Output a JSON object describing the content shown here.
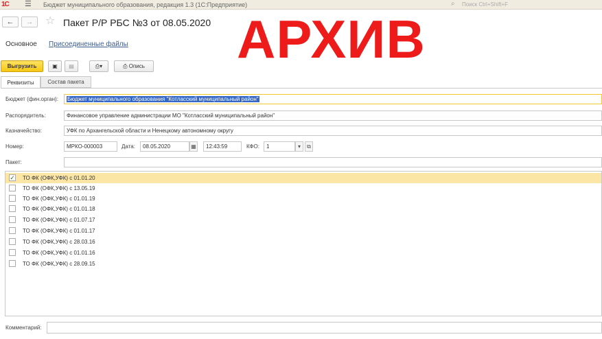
{
  "titlebar": {
    "logo": "1С",
    "app_title": "Бюджет муниципального образования, редакция 1.3  (1С:Предприятие)",
    "search_placeholder": "Поиск Ctrl+Shift+F"
  },
  "document": {
    "title": "Пакет Р/Р РБС №3 от 08.05.2020",
    "stamp": "АРХИВ"
  },
  "links": {
    "main": "Основное",
    "files": "Присоединенные файлы"
  },
  "toolbar": {
    "upload_label": "Выгрузить",
    "description_label": "Опись"
  },
  "tabs": [
    {
      "label": "Реквизиты",
      "active": true
    },
    {
      "label": "Состав пакета",
      "active": false
    }
  ],
  "form": {
    "budget": {
      "label": "Бюджет (фин.орган):",
      "value": "Бюджет муниципального образования \"Котласский муниципальный район\""
    },
    "manager": {
      "label": "Распорядитель:",
      "value": "Финансовое управление администрации МО \"Котласский муниципальный район\""
    },
    "treasury": {
      "label": "Казначейство:",
      "value": "УФК по Архангельской области и Ненецкому автономному округу"
    },
    "number": {
      "label": "Номер:",
      "value": "МРКО-000003"
    },
    "date": {
      "label": "Дата:",
      "value": "08.05.2020",
      "time": "12:43:59"
    },
    "kfo": {
      "label": "КФО:",
      "value": "1"
    },
    "package": {
      "label": "Пакет:",
      "value": ""
    },
    "comment": {
      "label": "Комментарий:",
      "value": ""
    }
  },
  "package_list": [
    {
      "label": "ТО ФК (ОФК,УФК) с 01.01.20",
      "checked": true
    },
    {
      "label": "ТО ФК (ОФК,УФК) с 13.05.19",
      "checked": false
    },
    {
      "label": "ТО ФК (ОФК,УФК) с 01.01.19",
      "checked": false
    },
    {
      "label": "ТО ФК (ОФК,УФК) с 01.01.18",
      "checked": false
    },
    {
      "label": "ТО ФК (ОФК,УФК) с 01.07.17",
      "checked": false
    },
    {
      "label": "ТО ФК (ОФК,УФК) с 01.01.17",
      "checked": false
    },
    {
      "label": "ТО ФК (ОФК,УФК) с 28.03.16",
      "checked": false
    },
    {
      "label": "ТО ФК (ОФК,УФК) с 01.01.16",
      "checked": false
    },
    {
      "label": "ТО ФК (ОФК,УФК) с 28.09.15",
      "checked": false
    }
  ]
}
